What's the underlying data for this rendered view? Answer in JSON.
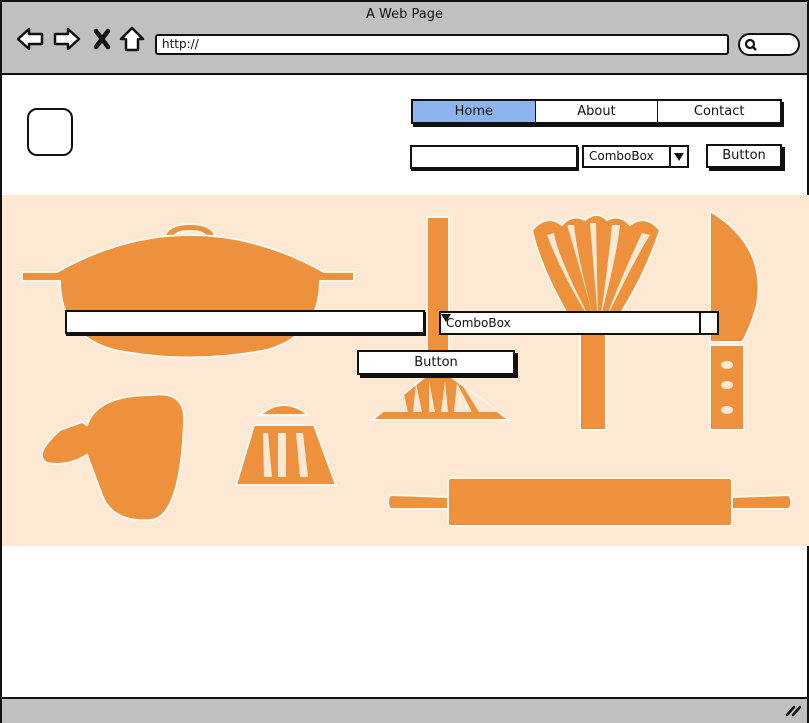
{
  "browser": {
    "title": "A Web Page",
    "url": "http://",
    "nav_icons": [
      "back-arrow-icon",
      "forward-arrow-icon",
      "stop-x-icon",
      "home-icon"
    ],
    "search_icon": "search-icon"
  },
  "header": {
    "logo": "logo-placeholder",
    "tabs": [
      {
        "label": "Home",
        "active": true
      },
      {
        "label": "About",
        "active": false
      },
      {
        "label": "Contact",
        "active": false
      }
    ],
    "search_input": {
      "value": "",
      "placeholder": ""
    },
    "combobox": {
      "selected": "ComboBox"
    },
    "button_label": "Button"
  },
  "hero": {
    "image": "kitchen-utensils-illustration",
    "colors": {
      "background": "#fce8d3",
      "accent": "#ee913d"
    },
    "text_input": {
      "value": "",
      "placeholder": ""
    },
    "combobox": {
      "selected": "ComboBox"
    },
    "button_label": "Button"
  },
  "colors": {
    "chrome": "#c0c0c0",
    "active_tab": "#8eb4ee"
  }
}
